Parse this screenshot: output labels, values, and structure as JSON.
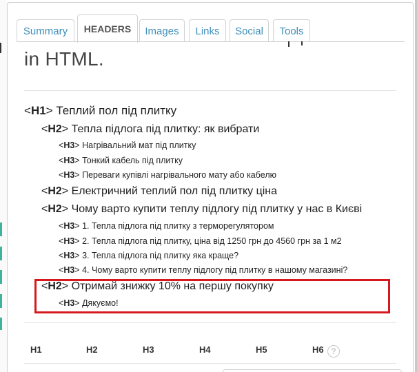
{
  "tabs": [
    {
      "label": "Summary",
      "active": false
    },
    {
      "label": "HEADERS",
      "active": true
    },
    {
      "label": "Images",
      "active": false
    },
    {
      "label": "Links",
      "active": false
    },
    {
      "label": "Social",
      "active": false
    },
    {
      "label": "Tools",
      "active": false
    }
  ],
  "intro_text": "in HTML.",
  "headings": [
    {
      "tag": "H1",
      "text": "Теплий пол під плитку"
    },
    {
      "tag": "H2",
      "text": "Тепла підлога під плитку: як вибрати"
    },
    {
      "tag": "H3",
      "text": "Нагрівальний мат під плитку"
    },
    {
      "tag": "H3",
      "text": "Тонкий кабель під плитку"
    },
    {
      "tag": "H3",
      "text": "Переваги купівлі нагрівального мату або кабелю"
    },
    {
      "tag": "H2",
      "text": "Електричний теплий пол під плитку ціна"
    },
    {
      "tag": "H2",
      "text": "Чому варто купити теплу підлогу під плитку у нас в Києві"
    },
    {
      "tag": "H3",
      "text": "1. Тепла підлога під плитку з терморегулятором"
    },
    {
      "tag": "H3",
      "text": "2. Тепла підлога під плитку, ціна від 1250 грн до 4560 грн за 1 м2"
    },
    {
      "tag": "H3",
      "text": "3. Тепла підлога під плитку яка краще?"
    },
    {
      "tag": "H3",
      "text": "4. Чому варто купити теплу підлогу під плитку в нашому магазині?"
    },
    {
      "tag": "H2",
      "text": "Отримай знижку 10% на першу покупку"
    },
    {
      "tag": "H3",
      "text": "Дякуємо!"
    }
  ],
  "stats_headers": [
    "H1",
    "H2",
    "H3",
    "H4",
    "H5",
    "H6"
  ],
  "help_glyph": "?",
  "colors": {
    "tab_link": "#3d8eb9",
    "highlight_border": "#d6191e",
    "accent_strip": "#3fb39a"
  }
}
